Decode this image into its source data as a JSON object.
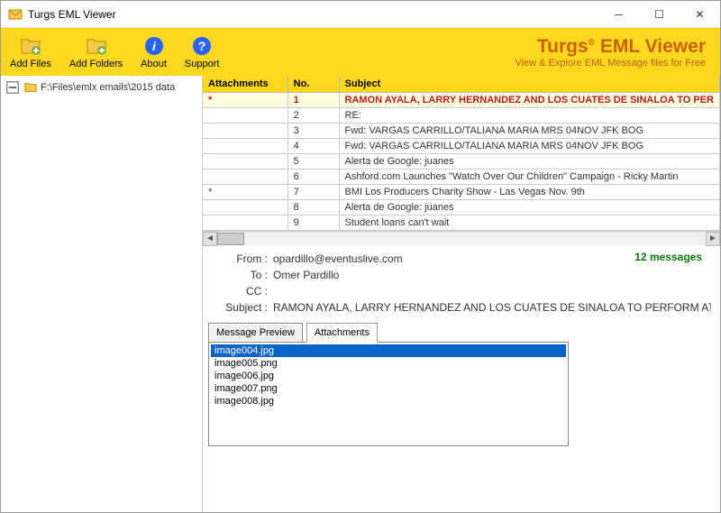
{
  "window": {
    "title": "Turgs EML Viewer"
  },
  "toolbar": {
    "add_files": "Add Files",
    "add_folders": "Add Folders",
    "about": "About",
    "support": "Support"
  },
  "brand": {
    "name_left": "Turgs",
    "name_right": "EML Viewer",
    "tagline": "View & Explore EML Message files for Free"
  },
  "tree": {
    "path": "F:\\Files\\emlx emails\\2015 data"
  },
  "columns": {
    "att": "Attachments",
    "no": "No.",
    "subject": "Subject"
  },
  "rows": [
    {
      "att": "*",
      "no": "1",
      "subject": "RAMON AYALA, LARRY HERNANDEZ AND LOS CUATES DE SINALOA TO PER",
      "sel": true
    },
    {
      "att": "",
      "no": "2",
      "subject": "RE:"
    },
    {
      "att": "",
      "no": "3",
      "subject": "Fwd: VARGAS CARRILLO/TALIANA MARIA MRS 04NOV JFK BOG"
    },
    {
      "att": "",
      "no": "4",
      "subject": "Fwd: VARGAS CARRILLO/TALIANA MARIA MRS 04NOV JFK BOG"
    },
    {
      "att": "",
      "no": "5",
      "subject": "Alerta de Google: juanes"
    },
    {
      "att": "",
      "no": "6",
      "subject": "Ashford.com Launches \"Watch Over Our Children\" Campaign - Ricky Martin"
    },
    {
      "att": "*",
      "no": "7",
      "subject": "BMI Los Producers Charity Show - Las Vegas Nov. 9th"
    },
    {
      "att": "",
      "no": "8",
      "subject": "Alerta de Google: juanes"
    },
    {
      "att": "",
      "no": "9",
      "subject": "Student loans can't wait"
    }
  ],
  "headers": {
    "from_label": "From :",
    "from": "opardillo@eventuslive.com",
    "to_label": "To :",
    "to": "Omer Pardillo",
    "cc_label": "CC :",
    "cc": "",
    "subject_label": "Subject :",
    "subject": "RAMON AYALA, LARRY HERNANDEZ AND LOS CUATES DE SINALOA TO PERFORM AT LATIN GRAM",
    "count": "12 messages"
  },
  "tabs": {
    "preview": "Message Preview",
    "attachments": "Attachments"
  },
  "attachments": [
    {
      "name": "image004.jpg",
      "sel": true
    },
    {
      "name": "image005.png"
    },
    {
      "name": "image006.jpg"
    },
    {
      "name": "image007.png"
    },
    {
      "name": "image008.jpg"
    }
  ]
}
